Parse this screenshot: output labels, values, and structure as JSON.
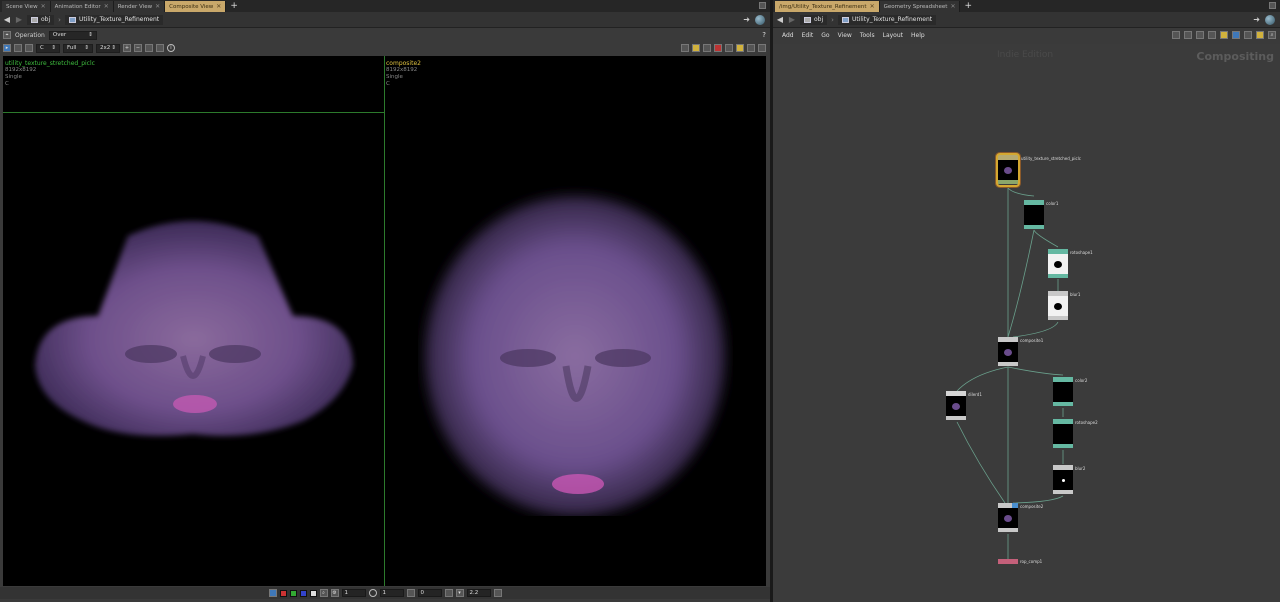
{
  "left_tabs": [
    {
      "label": "Scene View",
      "active": false
    },
    {
      "label": "Animation Editor",
      "active": false
    },
    {
      "label": "Render View",
      "active": false
    },
    {
      "label": "Composite View",
      "active": true
    }
  ],
  "right_tabs": [
    {
      "label": "/img/Utility_Texture_Refinement",
      "active": true
    },
    {
      "label": "Geometry Spreadsheet",
      "active": false
    }
  ],
  "path": {
    "root": "obj",
    "network": "Utility_Texture_Refinement"
  },
  "composite_toolbar": {
    "operation_label": "Operation",
    "operation_value": "Over",
    "channel": "C",
    "resolution": "Full",
    "layout": "2x2",
    "help": "?"
  },
  "viewer": {
    "left": {
      "name": "utility_texture_stretched_piclc",
      "res": "8192x8192",
      "mode": "Single",
      "plane": "C"
    },
    "right": {
      "name": "composite2",
      "res": "8192x8192",
      "mode": "Single",
      "plane": "C"
    }
  },
  "bottom_bar": {
    "frame": "1",
    "exposure": "1",
    "gamma_offset": "0",
    "gamma": "2.2"
  },
  "menu": [
    "Add",
    "Edit",
    "Go",
    "View",
    "Tools",
    "Layout",
    "Help"
  ],
  "network": {
    "edition": "Indie Edition",
    "context": "Compositing",
    "nodes": {
      "file": "utility_texture_stretched_piclc",
      "color1": "color1",
      "rotoshape1": "rotoshape1",
      "blur1": "blur1",
      "composite1": "composite1",
      "dilate": "dilerd1",
      "color2": "color2",
      "rotoshape2": "rotoshape2",
      "blur2": "blur2",
      "composite2": "composite2",
      "rop": "rop_comp1"
    }
  },
  "colors": {
    "active_tab": "#c9a86a",
    "node_teal": "#65b8a2",
    "rop_pink": "#c4607a",
    "selected": "#d4a830"
  }
}
